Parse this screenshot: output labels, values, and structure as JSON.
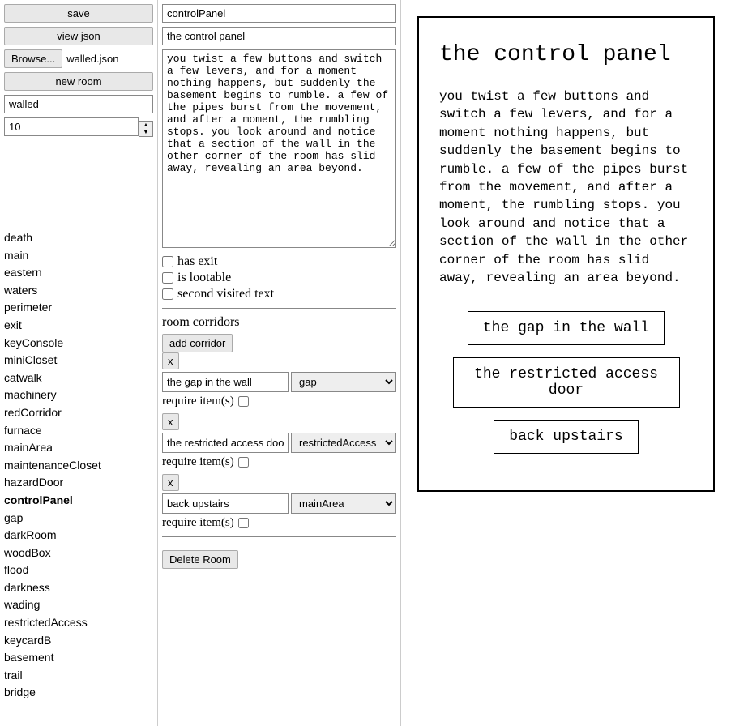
{
  "left": {
    "save_label": "save",
    "view_json_label": "view json",
    "browse_label": "Browse...",
    "filename": "walled.json",
    "new_room_label": "new room",
    "project_name": "walled",
    "number_value": "10",
    "rooms": [
      "death",
      "main",
      "eastern",
      "waters",
      "perimeter",
      "exit",
      "keyConsole",
      "miniCloset",
      "catwalk",
      "machinery",
      "redCorridor",
      "furnace",
      "mainArea",
      "maintenanceCloset",
      "hazardDoor",
      "controlPanel",
      "gap",
      "darkRoom",
      "woodBox",
      "flood",
      "darkness",
      "wading",
      "restrictedAccess",
      "keycardB",
      "basement",
      "trail",
      "bridge"
    ],
    "selected_room": "controlPanel"
  },
  "mid": {
    "room_id": "controlPanel",
    "room_title": "the control panel",
    "room_desc": "you twist a few buttons and switch a few levers, and for a moment nothing happens, but suddenly the basement begins to rumble. a few of the pipes burst from the movement, and after a moment, the rumbling stops. you look around and notice that a section of the wall in the other corner of the room has slid away, revealing an area beyond.",
    "chk_has_exit": "has exit",
    "chk_is_lootable": "is lootable",
    "chk_second_visited": "second visited text",
    "corridors_label": "room corridors",
    "add_corridor_label": "add corridor",
    "require_label": "require item(s)",
    "delete_label": "Delete Room",
    "x_label": "x",
    "corridors": [
      {
        "label": "the gap in the wall",
        "target": "gap"
      },
      {
        "label": "the restricted access door",
        "target": "restrictedAccess"
      },
      {
        "label": "back upstairs",
        "target": "mainArea"
      }
    ]
  },
  "preview": {
    "title": "the control panel",
    "desc": "you twist a few buttons and switch a few levers, and for a moment nothing happens, but suddenly the basement begins to rumble. a few of the pipes burst from the movement, and after a moment, the rumbling stops. you look around and notice that a section of the wall in the other corner of the room has slid away, revealing an area beyond.",
    "links": [
      "the gap in the wall",
      "the restricted access door",
      "back upstairs"
    ]
  }
}
